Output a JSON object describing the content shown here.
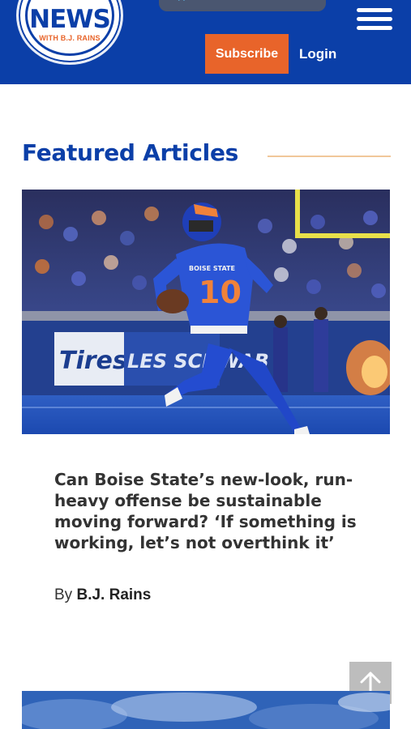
{
  "header": {
    "logo": {
      "title": "NEWS",
      "subtitle": "WITH B.J. RAINS"
    },
    "subscribe_label": "Subscribe",
    "login_label": "Login",
    "menu_icon": "hamburger-menu-icon",
    "colors": {
      "background": "#0b3fa8",
      "subscribe_button": "#e8642a"
    }
  },
  "featured": {
    "heading": "Featured Articles",
    "articles": [
      {
        "title": "Can Boise State’s new-look, run-heavy offense be sustainable moving forward? ‘If something is working, let’s not overthink it’",
        "byline_prefix": "By",
        "author": "B.J. Rains",
        "image": {
          "jersey_team": "BOISE STATE",
          "jersey_number": "10",
          "sign_text_1": "Tires",
          "sign_text_2": "LES SCHWAB"
        }
      }
    ]
  },
  "scroll_top_icon": "arrow-up-icon",
  "accent_colors": {
    "heading": "#0b3fa8",
    "rule": "#f1c79a",
    "text": "#333333"
  }
}
